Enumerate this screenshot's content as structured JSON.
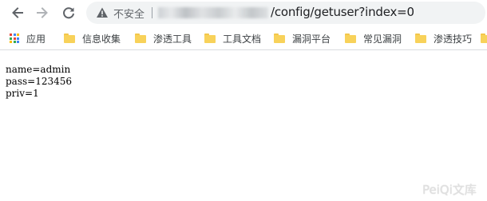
{
  "toolbar": {
    "back_icon": "arrow-left-icon",
    "forward_icon": "arrow-right-icon",
    "reload_icon": "reload-icon",
    "security_label": "不安全",
    "url_visible": "/config/getuser?index=0"
  },
  "bookmarks": [
    {
      "label": "应用",
      "icon": "apps-icon"
    },
    {
      "label": "信息收集",
      "icon": "folder-icon"
    },
    {
      "label": "渗透工具",
      "icon": "folder-icon"
    },
    {
      "label": "工具文档",
      "icon": "folder-icon"
    },
    {
      "label": "漏洞平台",
      "icon": "folder-icon"
    },
    {
      "label": "常见漏洞",
      "icon": "folder-icon"
    },
    {
      "label": "渗透技巧",
      "icon": "folder-icon"
    }
  ],
  "page": {
    "lines": [
      "name=admin",
      "pass=123456",
      "priv=1"
    ]
  },
  "watermark": "PeiQi文库"
}
